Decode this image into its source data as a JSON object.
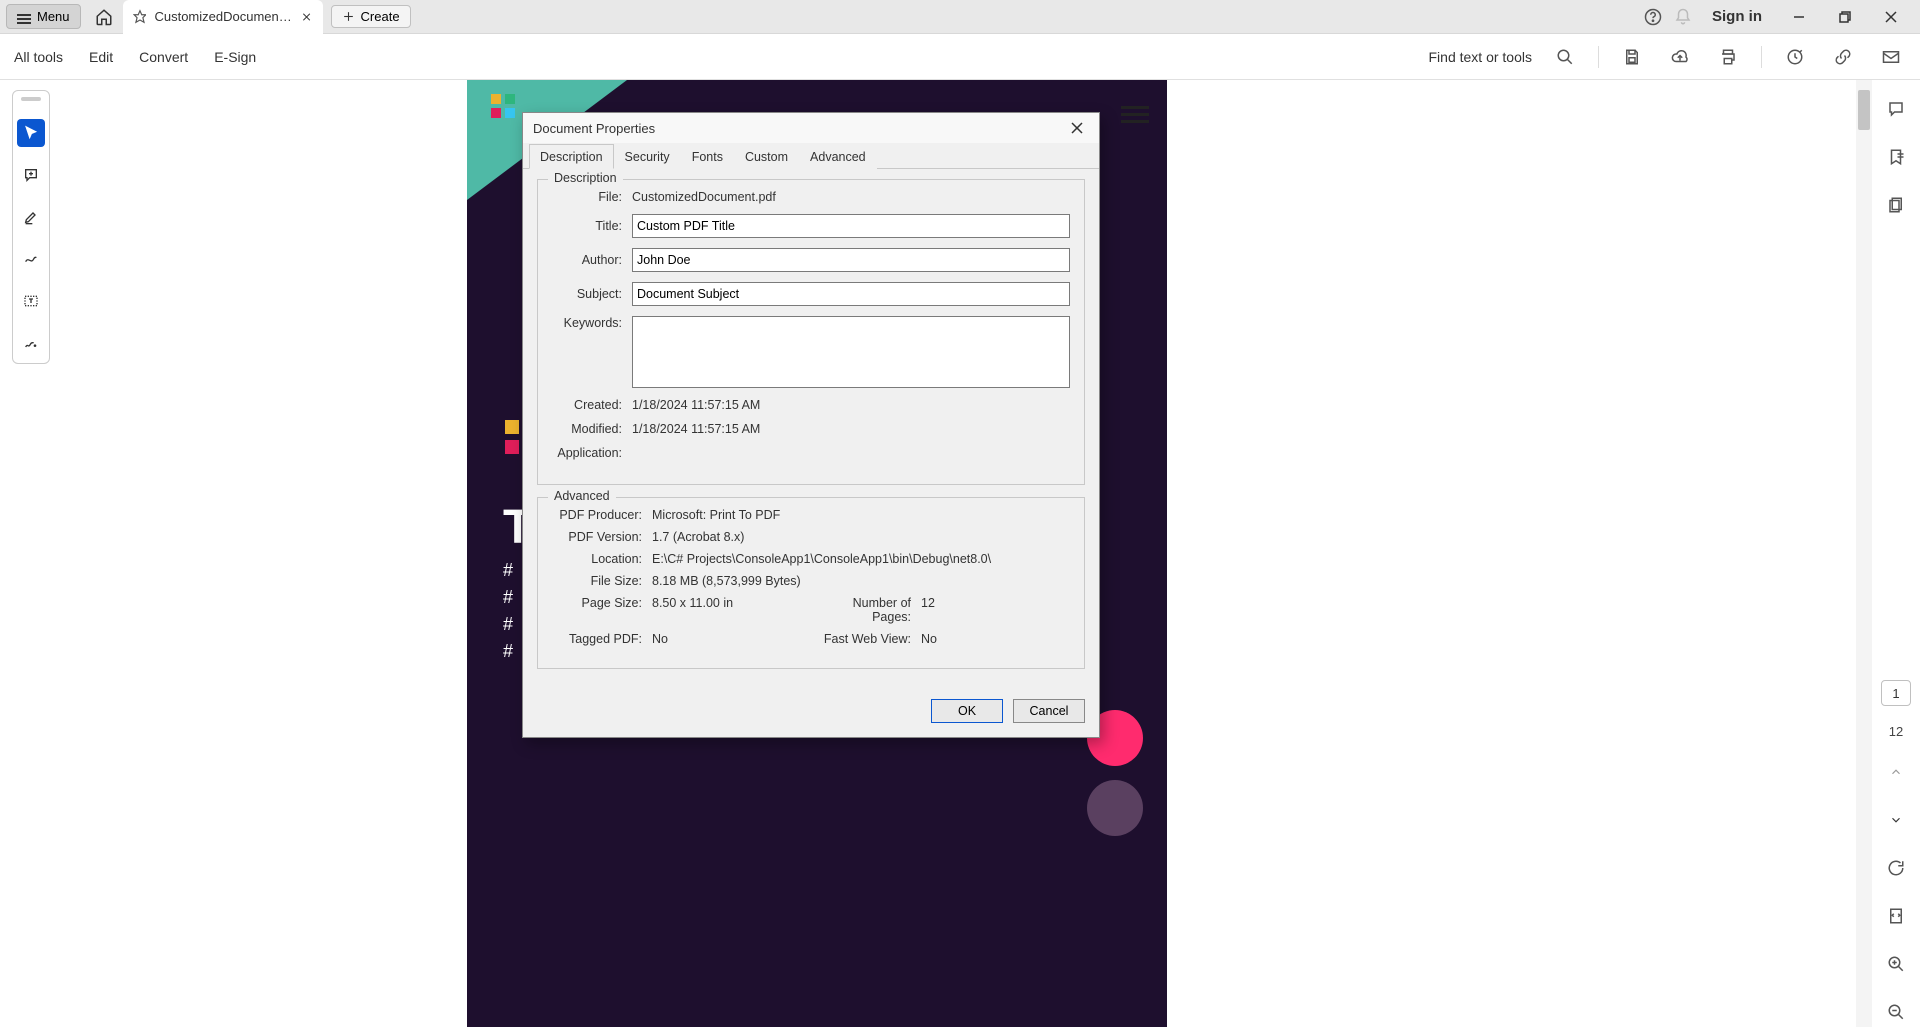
{
  "titlebar": {
    "menu_label": "Menu",
    "tab_title": "CustomizedDocument.p...",
    "create_label": "Create",
    "signin_label": "Sign in"
  },
  "toolbar": {
    "all_tools": "All tools",
    "edit": "Edit",
    "convert": "Convert",
    "esign": "E-Sign",
    "find_label": "Find text or tools"
  },
  "right_panel": {
    "current_page": "1",
    "total_pages": "12"
  },
  "dialog": {
    "title": "Document Properties",
    "tabs": {
      "description": "Description",
      "security": "Security",
      "fonts": "Fonts",
      "custom": "Custom",
      "advanced": "Advanced"
    },
    "desc_legend": "Description",
    "adv_legend": "Advanced",
    "labels": {
      "file": "File:",
      "title": "Title:",
      "author": "Author:",
      "subject": "Subject:",
      "keywords": "Keywords:",
      "created": "Created:",
      "modified": "Modified:",
      "application": "Application:",
      "producer": "PDF Producer:",
      "version": "PDF Version:",
      "location": "Location:",
      "filesize": "File Size:",
      "pagesize": "Page Size:",
      "numpages": "Number of Pages:",
      "tagged": "Tagged PDF:",
      "fastweb": "Fast Web View:"
    },
    "values": {
      "file": "CustomizedDocument.pdf",
      "title": "Custom PDF Title",
      "author": "John Doe",
      "subject": "Document Subject",
      "keywords": "",
      "created": "1/18/2024 11:57:15 AM",
      "modified": "1/18/2024 11:57:15 AM",
      "application": "",
      "producer": "Microsoft: Print To PDF",
      "version": "1.7 (Acrobat 8.x)",
      "location": "E:\\C# Projects\\ConsoleApp1\\ConsoleApp1\\bin\\Debug\\net8.0\\",
      "filesize": "8.18 MB (8,573,999 Bytes)",
      "pagesize": "8.50 x 11.00 in",
      "numpages": "12",
      "tagged": "No",
      "fastweb": "No"
    },
    "buttons": {
      "ok": "OK",
      "cancel": "Cancel"
    }
  }
}
